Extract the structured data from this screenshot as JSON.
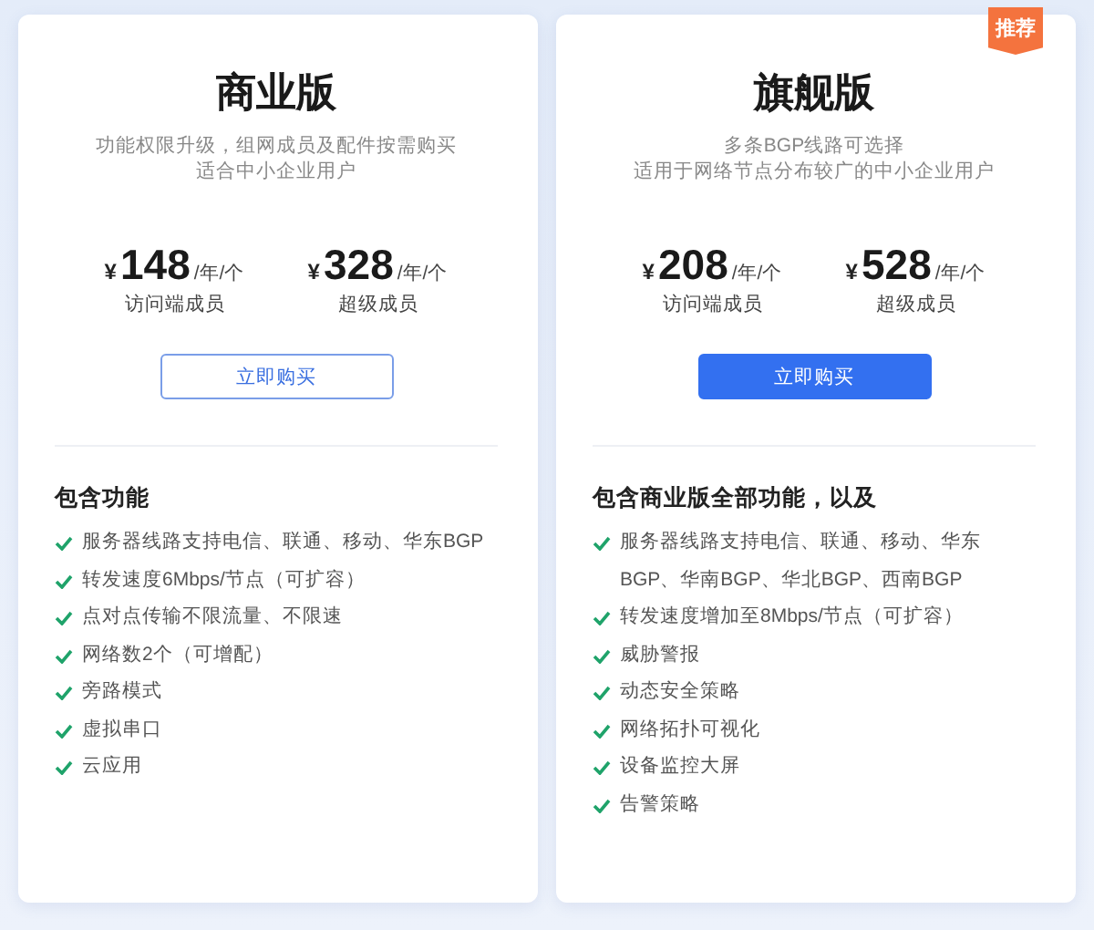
{
  "plans": [
    {
      "title": "商业版",
      "description": [
        "功能权限升级，组网成员及配件按需购买",
        "适合中小企业用户"
      ],
      "prices": [
        {
          "currency": "¥",
          "amount": "148",
          "unit": "/年/个",
          "label": "访问端成员"
        },
        {
          "currency": "¥",
          "amount": "328",
          "unit": "/年/个",
          "label": "超级成员"
        }
      ],
      "button": {
        "label": "立即购买",
        "kind": "outline"
      },
      "features_title": "包含功能",
      "features": [
        "服务器线路支持电信、联通、移动、华东BGP",
        "转发速度6Mbps/节点（可扩容）",
        "点对点传输不限流量、不限速",
        "网络数2个（可增配）",
        "旁路模式",
        "虚拟串口",
        "云应用"
      ]
    },
    {
      "title": "旗舰版",
      "badge": "推荐",
      "description": [
        "多条BGP线路可选择",
        "适用于网络节点分布较广的中小企业用户"
      ],
      "prices": [
        {
          "currency": "¥",
          "amount": "208",
          "unit": "/年/个",
          "label": "访问端成员"
        },
        {
          "currency": "¥",
          "amount": "528",
          "unit": "/年/个",
          "label": "超级成员"
        }
      ],
      "button": {
        "label": "立即购买",
        "kind": "filled"
      },
      "features_title": "包含商业版全部功能，以及",
      "features": [
        "服务器线路支持电信、联通、移动、华东BGP、华南BGP、华北BGP、西南BGP",
        "转发速度增加至8Mbps/节点（可扩容）",
        "威胁警报",
        "动态安全策略",
        "网络拓扑可视化",
        "设备监控大屏",
        "告警策略"
      ]
    }
  ]
}
